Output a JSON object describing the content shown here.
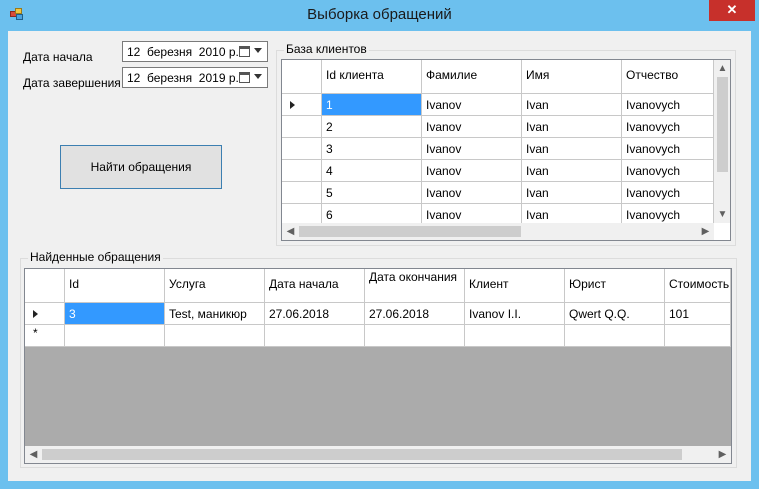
{
  "window": {
    "title": "Выборка обращений",
    "close_glyph": "✕"
  },
  "filters": {
    "start_label": "Дата начала",
    "start_value": "12  березня  2010 р.",
    "end_label": "Дата завершения",
    "end_value": "12  березня  2019 р."
  },
  "find_button": "Найти обращения",
  "clients": {
    "group_title": "База клиентов",
    "columns": [
      "Id клиента",
      "Фамилие",
      "Имя",
      "Отчество"
    ],
    "rows": [
      [
        "1",
        "Ivanov",
        "Ivan",
        "Ivanovych"
      ],
      [
        "2",
        "Ivanov",
        "Ivan",
        "Ivanovych"
      ],
      [
        "3",
        "Ivanov",
        "Ivan",
        "Ivanovych"
      ],
      [
        "4",
        "Ivanov",
        "Ivan",
        "Ivanovych"
      ],
      [
        "5",
        "Ivanov",
        "Ivan",
        "Ivanovych"
      ],
      [
        "6",
        "Ivanov",
        "Ivan",
        "Ivanovych"
      ]
    ]
  },
  "requests": {
    "group_title": "Найденные обращения",
    "columns": [
      "Id",
      "Услуга",
      "Дата начала",
      "Дата окончания",
      "Клиент",
      "Юрист",
      "Стоимость"
    ],
    "rows": [
      [
        "3",
        "Test, маникюр",
        "27.06.2018",
        "27.06.2018",
        "Ivanov I.I.",
        "Qwert Q.Q.",
        "101"
      ]
    ]
  },
  "icons": {
    "app": "app-icon",
    "calendar": "calendar-icon",
    "dropdown": "chevron-down-icon",
    "row_pointer": "row-pointer-icon",
    "new_row": "new-row-star-icon",
    "scroll_left": "◀",
    "scroll_right": "▶",
    "scroll_up": "▲",
    "scroll_down": "▼",
    "new_row_glyph": "*"
  },
  "colors": {
    "frame": "#6cc0ee",
    "selection": "#3399ff",
    "close": "#c7302b"
  }
}
